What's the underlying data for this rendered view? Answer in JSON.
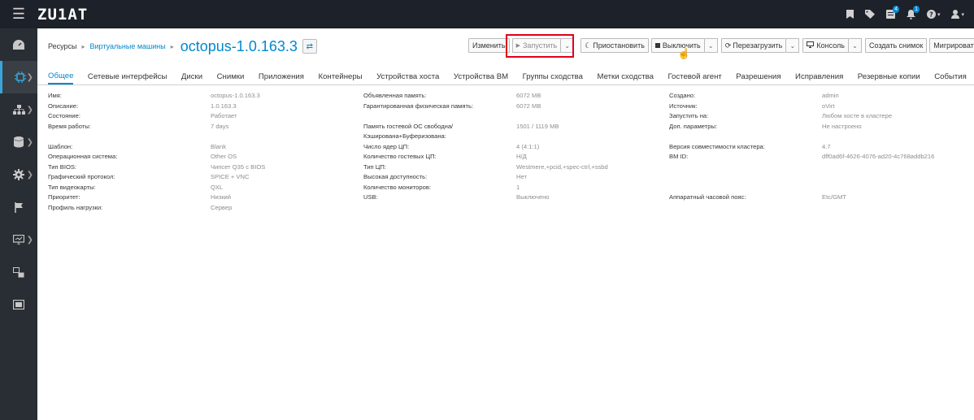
{
  "app": {
    "logo": "ZU1AT"
  },
  "breadcrumb": {
    "root": "Ресурсы",
    "section": "Виртуальные машины",
    "title": "octopus-1.0.163.3"
  },
  "toolbar": {
    "edit": "Изменить",
    "run": "Запустить",
    "suspend": "Приостановить",
    "shutdown": "Выключить",
    "reboot": "Перезагрузить",
    "console": "Консоль",
    "snapshot": "Создать снимок",
    "migrate": "Мигрировать"
  },
  "header_icons": {
    "tasks_badge": "4",
    "notifications_badge": "1"
  },
  "tabs": [
    "Общее",
    "Сетевые интерфейсы",
    "Диски",
    "Снимки",
    "Приложения",
    "Контейнеры",
    "Устройства хоста",
    "Устройства ВМ",
    "Группы сходства",
    "Метки сходства",
    "Гостевой агент",
    "Разрешения",
    "Исправления",
    "Резервные копии",
    "События"
  ],
  "details": {
    "col1": [
      {
        "label": "Имя:",
        "value": "octopus-1.0.163.3"
      },
      {
        "label": "Описание:",
        "value": "1.0.163.3"
      },
      {
        "label": "Состояние:",
        "value": "Работает"
      },
      {
        "label": "Время работы:",
        "value": "7 days"
      },
      {
        "label": "Шаблон:",
        "value": "Blank"
      },
      {
        "label": "Операционная система:",
        "value": "Other OS"
      },
      {
        "label": "Тип BIOS:",
        "value": "Чипсет Q35 с BIOS"
      },
      {
        "label": "Графический протокол:",
        "value": "SPICE + VNC"
      },
      {
        "label": "Тип видеокарты:",
        "value": "QXL"
      },
      {
        "label": "Приоритет:",
        "value": "Низкий"
      },
      {
        "label": "Профиль нагрузки:",
        "value": "Сервер"
      }
    ],
    "col2": [
      {
        "label": "Объявленная память:",
        "value": "6072 MB"
      },
      {
        "label": "Гарантированная физическая память:",
        "value": "6072 MB"
      },
      {
        "label": "Память гостевой ОС свободна/",
        "value": "1501 / 1119 MB"
      },
      {
        "label": "Кэширована+Буферизована:",
        "value": ""
      },
      {
        "label": "Число ядер ЦП:",
        "value": "4 (4:1:1)"
      },
      {
        "label": "Количество гостевых ЦП:",
        "value": "Н/Д"
      },
      {
        "label": "Тип ЦП:",
        "value": "Westmere,+pcid,+spec-ctrl,+ssbd"
      },
      {
        "label": "Высокая доступность:",
        "value": "Нет"
      },
      {
        "label": "Количество мониторов:",
        "value": "1"
      },
      {
        "label": "USB:",
        "value": "Выключено"
      }
    ],
    "col3": [
      {
        "label": "Создано:",
        "value": "admin"
      },
      {
        "label": "Источник:",
        "value": "oVirt"
      },
      {
        "label": "Запустить на:",
        "value": "Любом хосте в кластере"
      },
      {
        "label": "Доп. параметры:",
        "value": "Не настроено"
      },
      {
        "label": "Версия совместимости кластера:",
        "value": "4.7"
      },
      {
        "label": "ВМ ID:",
        "value": "dff0ad6f-4626-4076-ad20-4c768addb216"
      },
      {
        "label": "Аппаратный часовой пояс:",
        "value": "Etc/GMT"
      }
    ]
  },
  "colors": {
    "accent": "#0088ce",
    "topbar": "#1d2129",
    "sidebar": "#292e34",
    "highlight": "#e0001a"
  }
}
